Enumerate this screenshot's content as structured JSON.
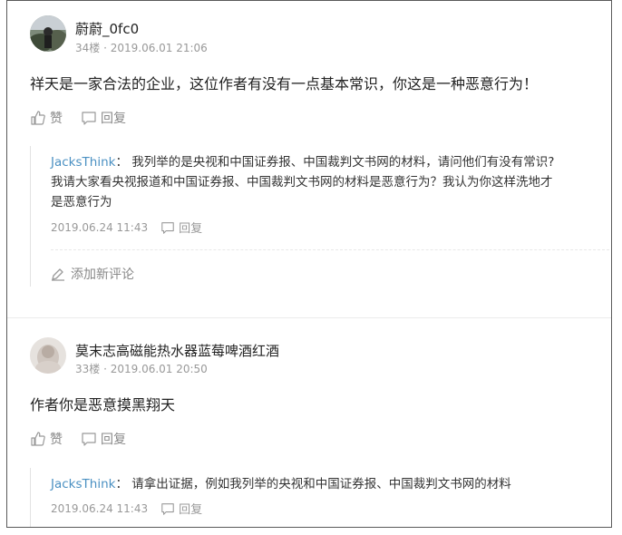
{
  "comments": [
    {
      "author": "蔚蔚_0fc0",
      "meta": "34楼 · 2019.06.01 21:06",
      "text": "祥天是一家合法的企业，这位作者有没有一点基本常识，你这是一种恶意行为！",
      "like_label": "赞",
      "reply_label": "回复",
      "replies": [
        {
          "user": "JacksThink",
          "sep": "：",
          "line1": "我列举的是央视和中国证券报、中国裁判文书网的材料，请问他们有没有常识?",
          "line2": "我请大家看央视报道和中国证券报、中国裁判文书网的材料是恶意行为？我认为你这样洗地才",
          "line3": "是恶意行为",
          "time": "2019.06.24 11:43",
          "reply_label": "回复"
        }
      ],
      "add_comment_label": "添加新评论"
    },
    {
      "author": "莫末志高磁能热水器蓝莓啤酒红酒",
      "meta": "33楼 · 2019.06.01 20:50",
      "text": "作者你是恶意摸黑翔天",
      "like_label": "赞",
      "reply_label": "回复",
      "replies": [
        {
          "user": "JacksThink",
          "sep": "：",
          "line1": "请拿出证据，例如我列举的央视和中国证券报、中国裁判文书网的材料",
          "time": "2019.06.24 11:43",
          "reply_label": "回复"
        }
      ]
    }
  ]
}
